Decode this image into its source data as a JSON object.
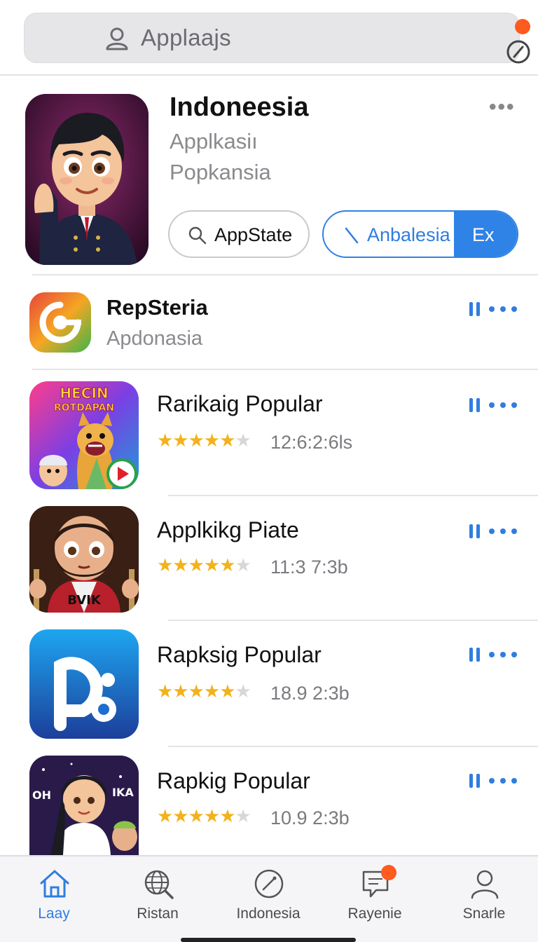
{
  "search": {
    "text": "Applaajs"
  },
  "featured": {
    "title": "Indoneesia",
    "subtitle1": "Applkasiı",
    "subtitle2": "Popkansia",
    "button1_label": "AppState",
    "button2_label": "Anbalesia",
    "button2_tag": "Ex"
  },
  "apps": [
    {
      "title": "RepSteria",
      "subtitle": "Apdonasia"
    },
    {
      "title": "Rarikaig Popular",
      "rating": 4.5,
      "meta": "12:6:2:6ls"
    },
    {
      "title": "Applkikg Piate",
      "rating": 4.5,
      "meta": "11:3 7:3b"
    },
    {
      "title": "Rapksig Popular",
      "rating": 4.5,
      "meta": "18.9 2:3b"
    },
    {
      "title": "Rapkig Popular",
      "rating": 4.5,
      "meta": "10.9 2:3b"
    }
  ],
  "poster_texts": {
    "line1": "HECIN",
    "line2": "ROTDAPAN",
    "shirt": "BVIK",
    "left": "OH",
    "right": "IKA"
  },
  "tabs": [
    {
      "label": "Laay",
      "icon": "home-icon",
      "active": true
    },
    {
      "label": "Ristan",
      "icon": "globe-search-icon"
    },
    {
      "label": "Indonesia",
      "icon": "compass-icon"
    },
    {
      "label": "Rayenie",
      "icon": "chat-icon",
      "badge": true
    },
    {
      "label": "Snarle",
      "icon": "person-icon"
    }
  ],
  "colors": {
    "accent": "#2f7de0",
    "star": "#f1b21c",
    "badge": "#ff5a1f"
  }
}
